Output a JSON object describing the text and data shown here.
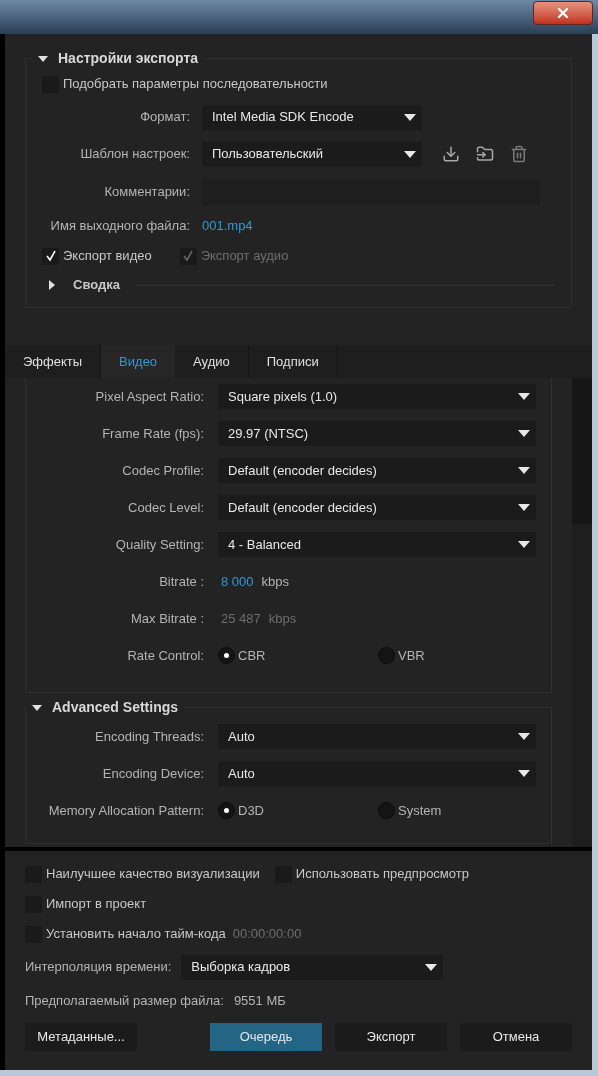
{
  "export_settings": {
    "title": "Настройки экспорта",
    "expanded": true,
    "match_sequence": {
      "label": "Подобрать параметры последовательности",
      "checked": false
    },
    "format": {
      "label": "Формат:",
      "value": "Intel Media SDK Encode"
    },
    "preset": {
      "label": "Шаблон настроек:",
      "value": "Пользовательский"
    },
    "comments": {
      "label": "Комментарии:"
    },
    "output_name": {
      "label": "Имя выходного файла:",
      "value": "001.mp4"
    },
    "export_video": {
      "label": "Экспорт видео",
      "checked": true,
      "disabled": false
    },
    "export_audio": {
      "label": "Экспорт аудио",
      "checked": true,
      "disabled": true
    },
    "summary": {
      "title": "Сводка",
      "expanded": false
    }
  },
  "tabs": [
    {
      "label": "Эффекты",
      "selected": false
    },
    {
      "label": "Видео",
      "selected": true
    },
    {
      "label": "Аудио",
      "selected": false
    },
    {
      "label": "Подписи",
      "selected": false
    }
  ],
  "video_settings": [
    {
      "kind": "dropdown",
      "label": "Pixel Aspect Ratio:",
      "value": "Square pixels (1.0)"
    },
    {
      "kind": "dropdown",
      "label": "Frame Rate (fps):",
      "value": "29.97 (NTSC)"
    },
    {
      "kind": "dropdown",
      "label": "Codec Profile:",
      "value": "Default (encoder decides)"
    },
    {
      "kind": "dropdown",
      "label": "Codec Level:",
      "value": "Default (encoder decides)"
    },
    {
      "kind": "dropdown",
      "label": "Quality Setting:",
      "value": "4 - Balanced"
    },
    {
      "kind": "number",
      "label": "Bitrate :",
      "value": "8 000",
      "unit": "kbps",
      "disabled": false
    },
    {
      "kind": "number",
      "label": "Max Bitrate :",
      "value": "25 487",
      "unit": "kbps",
      "disabled": true
    },
    {
      "kind": "radio",
      "label": "Rate Control:",
      "options": [
        {
          "label": "CBR",
          "selected": true
        },
        {
          "label": "VBR",
          "selected": false
        }
      ]
    }
  ],
  "advanced_settings": {
    "title": "Advanced Settings",
    "expanded": true,
    "rows": [
      {
        "kind": "dropdown",
        "label": "Encoding Threads:",
        "value": "Auto"
      },
      {
        "kind": "dropdown",
        "label": "Encoding Device:",
        "value": "Auto"
      },
      {
        "kind": "radio",
        "label": "Memory Allocation Pattern:",
        "options": [
          {
            "label": "D3D",
            "selected": true
          },
          {
            "label": "System",
            "selected": false
          }
        ]
      }
    ]
  },
  "option_rows": [
    {
      "options": [
        {
          "label": "Наилучшее качество визуализации",
          "checked": false
        },
        {
          "label": "Использовать предпросмотр",
          "checked": false
        }
      ]
    },
    {
      "options": [
        {
          "label": "Импорт в проект",
          "checked": false
        }
      ]
    },
    {
      "options": [
        {
          "label": "Установить начало тайм-кода",
          "checked": false
        }
      ],
      "timecode": "00:00:00:00"
    }
  ],
  "interpolation": {
    "label": "Интерполяция времени:",
    "value": "Выборка кадров"
  },
  "file_size": {
    "label": "Предполагаемый размер файла:",
    "value": "9551 МБ"
  },
  "metadata_button": "Метаданные...",
  "action_buttons": [
    {
      "label": "Очередь",
      "kind": "primary"
    },
    {
      "label": "Экспорт",
      "kind": "default"
    },
    {
      "label": "Отмена",
      "kind": "default"
    }
  ]
}
